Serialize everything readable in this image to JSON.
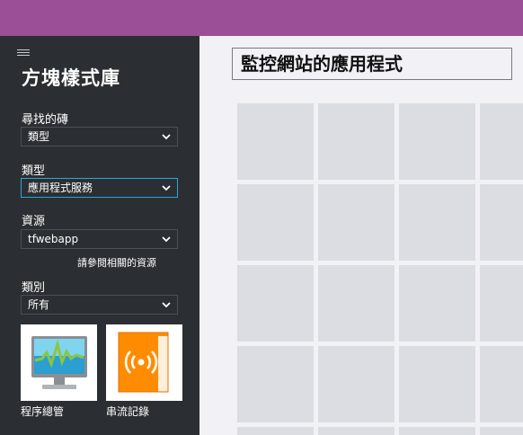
{
  "sidebar": {
    "title": "方塊樣式庫",
    "find_by": {
      "label": "尋找的磚",
      "value": "類型"
    },
    "type": {
      "label": "類型",
      "value": "應用程式服務"
    },
    "resource": {
      "label": "資源",
      "value": "tfwebapp",
      "related_link": "請參閱相關的資源"
    },
    "category": {
      "label": "類別",
      "value": "所有"
    },
    "tiles": [
      {
        "label": "程序總管",
        "icon": "monitor-chart-icon",
        "color": "#ffffff"
      },
      {
        "label": "串流記錄",
        "icon": "streaming-book-icon",
        "color": "#ff8c00"
      }
    ]
  },
  "main": {
    "title": "監控網站的應用程式"
  },
  "colors": {
    "topbar": "#9b4f96",
    "sidebar": "#2b2f33",
    "active_border": "#2aa7d8",
    "canvas": "#f1f1f6",
    "grid_cell": "#dcdde2"
  }
}
